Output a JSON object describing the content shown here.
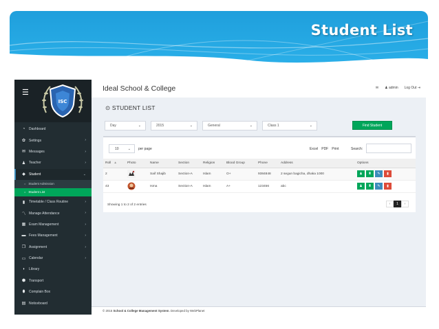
{
  "slide": {
    "title": "Student List"
  },
  "app": {
    "school_name": "Ideal School & College",
    "user": "admin",
    "logout": "Log Out",
    "page_title": "STUDENT LIST"
  },
  "sidebar": {
    "items": [
      {
        "label": "Dashboard",
        "icon": "dashboard-icon",
        "glyph": "◔",
        "chevron": false
      },
      {
        "label": "Settings",
        "icon": "gear-icon",
        "glyph": "✿",
        "chevron": true
      },
      {
        "label": "Messages",
        "icon": "envelope-icon",
        "glyph": "✉",
        "chevron": true
      },
      {
        "label": "Teacher",
        "icon": "users-icon",
        "glyph": "♟",
        "chevron": true
      },
      {
        "label": "Student",
        "icon": "graduation-cap-icon",
        "glyph": "◆",
        "chevron": true,
        "active": true
      },
      {
        "label": "Timetable / Class Routine",
        "icon": "bar-chart-icon",
        "glyph": "▮",
        "chevron": true
      },
      {
        "label": "Manage Attendance",
        "icon": "line-chart-icon",
        "glyph": "〽",
        "chevron": true
      },
      {
        "label": "Exam Management",
        "icon": "building-icon",
        "glyph": "▦",
        "chevron": true
      },
      {
        "label": "Fees Management",
        "icon": "money-icon",
        "glyph": "▬",
        "chevron": true
      },
      {
        "label": "Assignment",
        "icon": "copy-icon",
        "glyph": "❐",
        "chevron": true
      },
      {
        "label": "Calendar",
        "icon": "calendar-icon",
        "glyph": "▭",
        "chevron": true
      },
      {
        "label": "Library",
        "icon": "book-icon",
        "glyph": "◗",
        "chevron": false
      },
      {
        "label": "Transport",
        "icon": "map-marker-icon",
        "glyph": "⬢",
        "chevron": false
      },
      {
        "label": "Complain Box",
        "icon": "microphone-icon",
        "glyph": "⬮",
        "chevron": false
      },
      {
        "label": "Noticeboard",
        "icon": "clipboard-icon",
        "glyph": "▤",
        "chevron": false
      }
    ],
    "student_sub": [
      {
        "label": "Student Admission"
      },
      {
        "label": "Student List",
        "current": true
      }
    ]
  },
  "filters": {
    "shift": "Day",
    "year": "2015",
    "group": "General",
    "class": "Class 1",
    "find_label": "Find Student"
  },
  "table_controls": {
    "page_length": "10",
    "per_page_label": "per page",
    "excel": "Excel",
    "pdf": "PDF",
    "print": "Print",
    "search_label": "Search:"
  },
  "table": {
    "columns": [
      "Roll",
      "Photo",
      "Name",
      "Section",
      "Religion",
      "Blood Group",
      "Phone",
      "Address",
      "Options"
    ],
    "rows": [
      {
        "roll": "2",
        "name": "Saif Shajib",
        "section": "Section-A",
        "religion": "Islam",
        "blood": "O+",
        "phone": "9384848",
        "address": "2 segun bagicha, dhaka 1000"
      },
      {
        "roll": "43",
        "name": "Isma",
        "section": "Section-A",
        "religion": "Islam",
        "blood": "A+",
        "phone": "123456",
        "address": "abc"
      }
    ]
  },
  "table_info": "Showing 1 to 2 of 2 entries",
  "pagination": {
    "prev": "‹",
    "current": "1",
    "next": "›"
  },
  "footer": {
    "prefix": "© 2015",
    "system": "School & College Management System",
    "suffix": ". Developed by WebPlanet"
  },
  "colors": {
    "banner": "#1f9fdc",
    "sidebar": "#222d32",
    "success": "#00a65a",
    "primary": "#3c8dbc",
    "danger": "#dd4b39"
  }
}
